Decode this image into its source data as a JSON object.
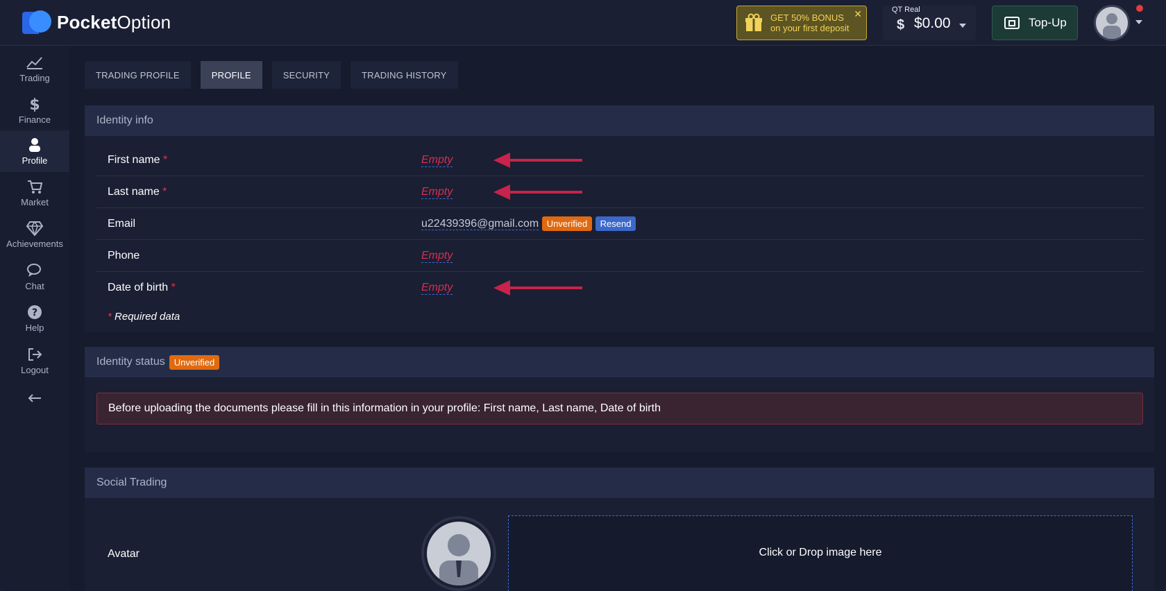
{
  "app": {
    "name_bold": "Pocket",
    "name_rest": "Option"
  },
  "header": {
    "bonus_line1": "GET 50% BONUS",
    "bonus_line2": "on your first deposit",
    "account_label": "QT Real",
    "account_balance": "$0.00",
    "topup_label": "Top-Up"
  },
  "sidebar": {
    "items": [
      {
        "label": "Trading",
        "icon": "chart-icon"
      },
      {
        "label": "Finance",
        "icon": "dollar-icon"
      },
      {
        "label": "Profile",
        "icon": "user-icon",
        "active": true
      },
      {
        "label": "Market",
        "icon": "cart-icon"
      },
      {
        "label": "Achievements",
        "icon": "diamond-icon"
      },
      {
        "label": "Chat",
        "icon": "chat-icon"
      },
      {
        "label": "Help",
        "icon": "help-icon"
      },
      {
        "label": "Logout",
        "icon": "logout-icon"
      }
    ]
  },
  "tabs": [
    {
      "label": "TRADING PROFILE"
    },
    {
      "label": "PROFILE",
      "active": true
    },
    {
      "label": "SECURITY"
    },
    {
      "label": "TRADING HISTORY"
    }
  ],
  "identity_info": {
    "title": "Identity info",
    "fields": [
      {
        "label": "First name",
        "required_mark": "*",
        "value": "Empty"
      },
      {
        "label": "Last name",
        "required_mark": "*",
        "value": "Empty"
      },
      {
        "label": "Email",
        "value": "u22439396@gmail.com",
        "badge": "Unverified",
        "action": "Resend"
      },
      {
        "label": "Phone",
        "value": "Empty"
      },
      {
        "label": "Date of birth",
        "required_mark": "*",
        "value": "Empty"
      }
    ],
    "required_note_mark": "*",
    "required_note": "Required data"
  },
  "identity_status": {
    "title": "Identity status",
    "badge": "Unverified",
    "alert": "Before uploading the documents please fill in this information in your profile: First name, Last name, Date of birth"
  },
  "social_trading": {
    "title": "Social Trading",
    "avatar_label": "Avatar",
    "dropzone_text": "Click or Drop image here"
  },
  "colors": {
    "accent_red": "#d42f52",
    "badge_orange": "#e06a10",
    "badge_blue": "#3b68c9",
    "bonus_yellow": "#f1d35a"
  }
}
